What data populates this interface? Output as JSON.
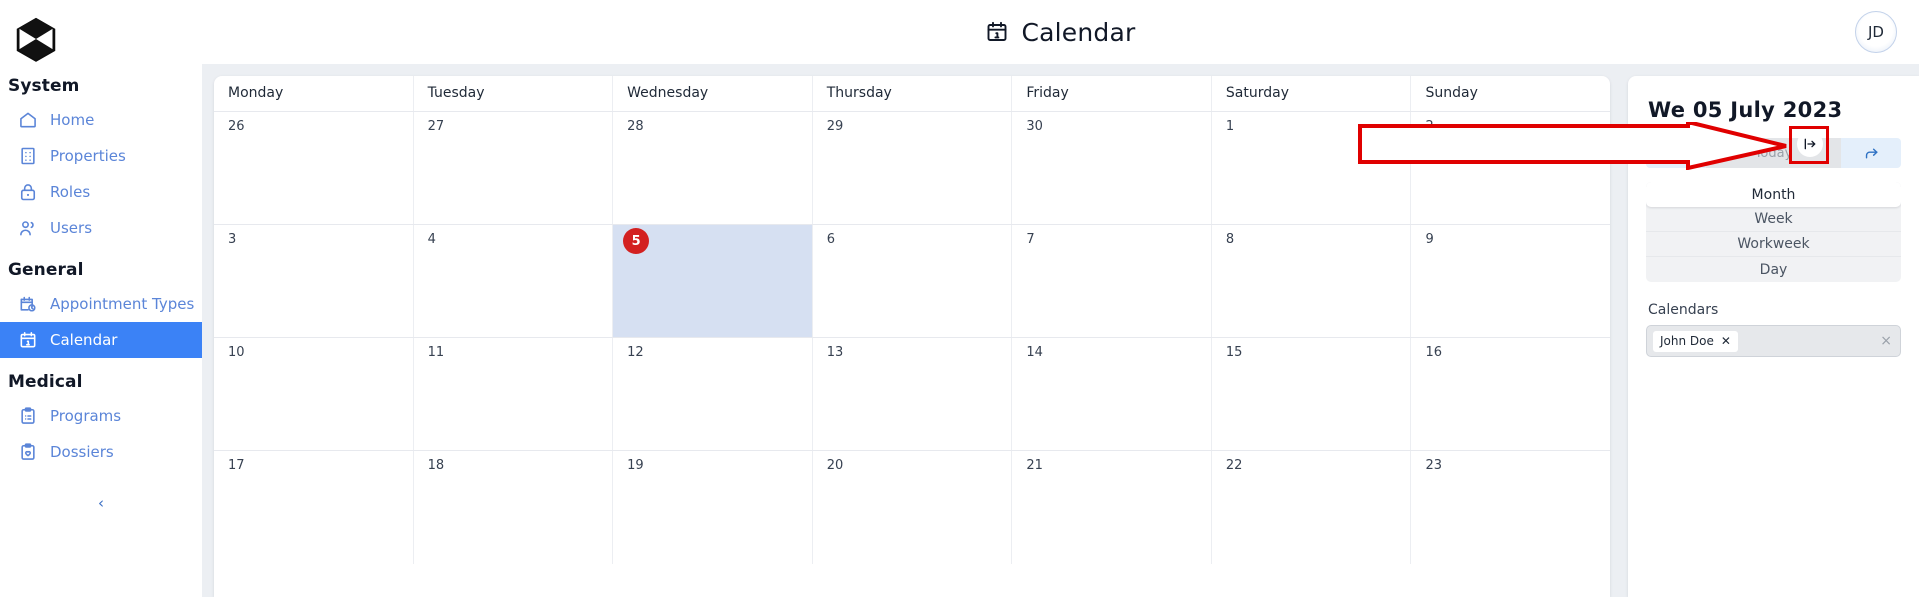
{
  "sidebar": {
    "logo_icon": "hexagon-logo-icon",
    "collapse_icon": "chevron-left-icon",
    "sections": [
      {
        "label": "System",
        "items": [
          {
            "label": "Home",
            "icon": "home-icon",
            "key": "home",
            "active": false
          },
          {
            "label": "Properties",
            "icon": "building-icon",
            "key": "properties",
            "active": false
          },
          {
            "label": "Roles",
            "icon": "lock-icon",
            "key": "roles",
            "active": false
          },
          {
            "label": "Users",
            "icon": "users-icon",
            "key": "users",
            "active": false
          }
        ]
      },
      {
        "label": "General",
        "items": [
          {
            "label": "Appointment Types",
            "icon": "calendar-clock-icon",
            "key": "appointment-types",
            "active": false
          },
          {
            "label": "Calendar",
            "icon": "calendar-icon",
            "key": "calendar",
            "active": true
          }
        ]
      },
      {
        "label": "Medical",
        "items": [
          {
            "label": "Programs",
            "icon": "clipboard-list-icon",
            "key": "programs",
            "active": false
          },
          {
            "label": "Dossiers",
            "icon": "clipboard-heart-icon",
            "key": "dossiers",
            "active": false
          }
        ]
      }
    ]
  },
  "topbar": {
    "title": "Calendar",
    "title_icon": "calendar-icon",
    "avatar_initials": "JD"
  },
  "calendar": {
    "panel_toggle_icon": "collapse-panel-right-icon",
    "weekdays": [
      "Monday",
      "Tuesday",
      "Wednesday",
      "Thursday",
      "Friday",
      "Saturday",
      "Sunday"
    ],
    "today_number": "5",
    "weeks": [
      [
        {
          "num": "26",
          "today": false
        },
        {
          "num": "27",
          "today": false
        },
        {
          "num": "28",
          "today": false
        },
        {
          "num": "29",
          "today": false
        },
        {
          "num": "30",
          "today": false
        },
        {
          "num": "1",
          "today": false
        },
        {
          "num": "2",
          "today": false
        }
      ],
      [
        {
          "num": "3",
          "today": false
        },
        {
          "num": "4",
          "today": false
        },
        {
          "num": "5",
          "today": true
        },
        {
          "num": "6",
          "today": false
        },
        {
          "num": "7",
          "today": false
        },
        {
          "num": "8",
          "today": false
        },
        {
          "num": "9",
          "today": false
        }
      ],
      [
        {
          "num": "10",
          "today": false
        },
        {
          "num": "11",
          "today": false
        },
        {
          "num": "12",
          "today": false
        },
        {
          "num": "13",
          "today": false
        },
        {
          "num": "14",
          "today": false
        },
        {
          "num": "15",
          "today": false
        },
        {
          "num": "16",
          "today": false
        }
      ],
      [
        {
          "num": "17",
          "today": false
        },
        {
          "num": "18",
          "today": false
        },
        {
          "num": "19",
          "today": false
        },
        {
          "num": "20",
          "today": false
        },
        {
          "num": "21",
          "today": false
        },
        {
          "num": "22",
          "today": false
        },
        {
          "num": "23",
          "today": false
        }
      ]
    ]
  },
  "side_panel": {
    "date_label": "We 05 July 2023",
    "prev_icon": "arrow-back-icon",
    "next_icon": "arrow-forward-icon",
    "today_label": "Today",
    "views": [
      {
        "label": "Month",
        "selected": true
      },
      {
        "label": "Week",
        "selected": false
      },
      {
        "label": "Workweek",
        "selected": false
      },
      {
        "label": "Day",
        "selected": false
      }
    ],
    "calendars_label": "Calendars",
    "selected_calendars": [
      {
        "name": "John Doe",
        "remove_icon": "close-x-icon"
      }
    ],
    "clear_all_icon": "close-x-icon",
    "clear_all_glyph": "×"
  },
  "annotation": {
    "arrow_color": "#e00000",
    "box_color": "#e00000",
    "points_to": "collapse-panel-right-button"
  },
  "colors": {
    "accent": "#3b82f6",
    "nav_link": "#5b85d8",
    "today_badge": "#d32121",
    "today_cell": "#d6e0f2",
    "app_bg": "#eceff3",
    "panel_bg": "#ffffff"
  }
}
